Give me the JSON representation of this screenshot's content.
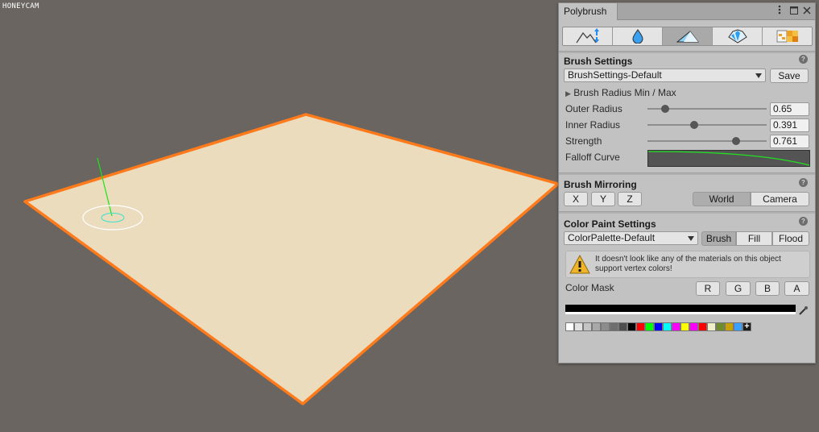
{
  "watermark": "HONEYCAM",
  "window": {
    "title": "Polybrush",
    "menu_icon": "kebab-menu-icon",
    "maximize_icon": "maximize-icon",
    "close_icon": "close-icon"
  },
  "toolbar": {
    "tools": [
      {
        "name": "sculpt-mode",
        "icon": "mountain-arrows-icon"
      },
      {
        "name": "smooth-mode",
        "icon": "water-drop-icon"
      },
      {
        "name": "paint-vertex-colors-mode",
        "icon": "paint-brush-icon",
        "active": true
      },
      {
        "name": "scatter-prefabs-mode",
        "icon": "crystals-icon"
      },
      {
        "name": "paint-textures-mode",
        "icon": "texture-tiles-icon"
      }
    ]
  },
  "brush_settings": {
    "title": "Brush Settings",
    "preset": "BrushSettings-Default",
    "save_label": "Save",
    "radius_foldout": "Brush Radius Min / Max",
    "outer_radius": {
      "label": "Outer Radius",
      "value": "0.65",
      "fraction": 0.15
    },
    "inner_radius": {
      "label": "Inner Radius",
      "value": "0.391",
      "fraction": 0.39
    },
    "strength": {
      "label": "Strength",
      "value": "0.761",
      "fraction": 0.74
    },
    "falloff_label": "Falloff Curve"
  },
  "brush_mirroring": {
    "title": "Brush Mirroring",
    "axes": [
      "X",
      "Y",
      "Z"
    ],
    "space_world": "World",
    "space_camera": "Camera"
  },
  "color_paint": {
    "title": "Color Paint Settings",
    "palette": "ColorPalette-Default",
    "mode_brush": "Brush",
    "mode_fill": "Fill",
    "mode_flood": "Flood",
    "warning": "It doesn't look like any of the materials on this object support vertex colors!",
    "color_mask_label": "Color Mask",
    "mask_r": "R",
    "mask_g": "G",
    "mask_b": "B",
    "mask_a": "A",
    "current_color": "#000000",
    "swatches": [
      "#ffffff",
      "#e0e0e0",
      "#c4c4c4",
      "#a8a8a8",
      "#8c8c8c",
      "#6e6e6e",
      "#4e4e4e",
      "#000000",
      "#ff0000",
      "#00ff00",
      "#0000ff",
      "#00ffff",
      "#ff00ff",
      "#ffff00",
      "#ff00ff",
      "#ff0000",
      "#f0f0c8",
      "#6e8c28",
      "#c8a000",
      "#3ca0ff"
    ]
  },
  "colors": {
    "selection_outline": "#ff7a1a",
    "plane_fill": "#ebdcbe",
    "viewport_bg": "#6b6561"
  }
}
